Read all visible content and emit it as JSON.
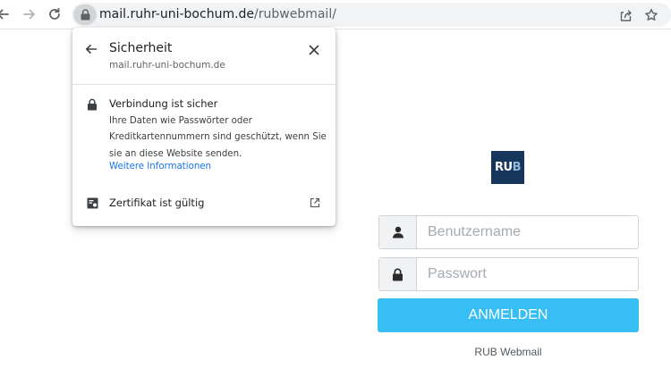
{
  "browser": {
    "url_host": "mail.ruhr-uni-bochum.de",
    "url_path": "/rubwebmail/",
    "icons": {
      "back": "arrow-left-icon",
      "forward": "arrow-right-icon",
      "reload": "reload-icon",
      "lock": "lock-icon",
      "share": "share-icon",
      "bookmark": "star-icon"
    }
  },
  "security_popup": {
    "title": "Sicherheit",
    "domain": "mail.ruhr-uni-bochum.de",
    "connection_title": "Verbindung ist sicher",
    "connection_description": "Ihre Daten wie Passwörter oder Kreditkartennummern sind geschützt, wenn Sie sie an diese Website senden.",
    "more_info_link": "Weitere Informationen",
    "certificate_label": "Zertifikat ist gültig",
    "link_color": "#1a73e8"
  },
  "login": {
    "logo_text_ru": "RU",
    "logo_text_b": "B",
    "username_placeholder": "Benutzername",
    "password_placeholder": "Passwort",
    "submit_label": "ANMELDEN",
    "footer": "RUB Webmail",
    "accent_color": "#37bff5",
    "logo_color": "#17365c"
  }
}
